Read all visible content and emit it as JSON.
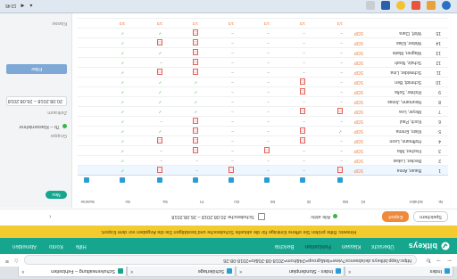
{
  "browser": {
    "tabs": [
      {
        "label": "Index",
        "active": false
      },
      {
        "label": "Index - Stundenplan",
        "active": false
      },
      {
        "label": "Schülertage",
        "active": false
      },
      {
        "label": "Schulverwaltung – Fehlzeiten",
        "active": true
      }
    ],
    "url": "https://app.bitkeys.de/absence?view=list&group=24&from=2018-08-20&to=2018-08-26",
    "clock_time": "12:45",
    "clock_date": "22.03.2018"
  },
  "app": {
    "brand": "bitkeys",
    "nav": [
      {
        "label": "Übersicht",
        "selected": false
      },
      {
        "label": "Klassen",
        "selected": false
      },
      {
        "label": "Fehlzeiten",
        "selected": true
      },
      {
        "label": "Berichte",
        "selected": false
      }
    ],
    "nav_right": [
      "Hilfe",
      "Konto",
      "Abmelden"
    ],
    "banner": "Hinweis: Bitte prüfen Sie offene Einträge für die aktuelle Schulwoche und bestätigen Sie die Angaben vor dem Export."
  },
  "toolbar": {
    "prev_label": "‹",
    "range_label": "Schulwoche 20.08.2018 – 26.08.2018",
    "status_label": "Alle aktiv",
    "export_label": "Export",
    "action_label": "Speichern"
  },
  "sidebar": {
    "class_label": "Klasse",
    "class_value": "7b – Klassenlehrer",
    "group_label": "Gruppe",
    "date_label": "Zeitraum",
    "date_value": "20.08.2018 – 26.08.2018",
    "apply_label": "Filter",
    "add_label": "Neu",
    "footer_label": "Mo 20.08"
  },
  "grid": {
    "headers": [
      "Nr.",
      "Schüler",
      "Kl.",
      "Mo",
      "Di",
      "Mi",
      "Do",
      "Fr",
      "Sa",
      "So",
      "Summe"
    ],
    "rows": [
      {
        "nr": "1",
        "name": "Bauer, Anna",
        "cls": "SOP",
        "m": [
          "box",
          "-",
          "-",
          "box",
          "-",
          "box",
          "ok"
        ]
      },
      {
        "nr": "2",
        "name": "Becker, Lukas",
        "cls": "SOP",
        "m": [
          "-",
          "-",
          "-",
          "-",
          "-",
          "-",
          "ok"
        ]
      },
      {
        "nr": "3",
        "name": "Fischer, Mia",
        "cls": "SOP",
        "m": [
          "-",
          "-",
          "box",
          "-",
          "box",
          "-",
          "ok"
        ]
      },
      {
        "nr": "4",
        "name": "Hoffmann, Leon",
        "cls": "SOP",
        "m": [
          "-",
          "box",
          "-",
          "-",
          "box",
          "box",
          "ok"
        ]
      },
      {
        "nr": "5",
        "name": "Klein, Emma",
        "cls": "SOP",
        "m": [
          "ok",
          "box",
          "-",
          "-",
          "box",
          "ok",
          "ok"
        ]
      },
      {
        "nr": "6",
        "name": "Koch, Paul",
        "cls": "SOP",
        "m": [
          "-",
          "-",
          "-",
          "-",
          "box",
          "-",
          "ok"
        ]
      },
      {
        "nr": "7",
        "name": "Meyer, Lea",
        "cls": "SOP",
        "m": [
          "box",
          "box",
          "-",
          "-",
          "ok",
          "ok",
          "ok"
        ]
      },
      {
        "nr": "8",
        "name": "Neumann, Jonas",
        "cls": "SOP",
        "m": [
          "-",
          "-",
          "-",
          "-",
          "ok",
          "ok",
          "ok"
        ]
      },
      {
        "nr": "9",
        "name": "Richter, Sofia",
        "cls": "SOP",
        "m": [
          "-",
          "box",
          "-",
          "-",
          "ok",
          "ok",
          "ok"
        ]
      },
      {
        "nr": "10",
        "name": "Schmidt, Ben",
        "cls": "SOP",
        "m": [
          "-",
          "box",
          "-",
          "-",
          "ok",
          "ok",
          "ok"
        ]
      },
      {
        "nr": "11",
        "name": "Schneider, Lina",
        "cls": "SOP",
        "m": [
          "-",
          "-",
          "-",
          "-",
          "box",
          "box",
          "ok"
        ]
      },
      {
        "nr": "12",
        "name": "Schulz, Noah",
        "cls": "SOP",
        "m": [
          "-",
          "-",
          "-",
          "-",
          "box",
          "-",
          "ok"
        ]
      },
      {
        "nr": "13",
        "name": "Wagner, Marie",
        "cls": "SOP",
        "m": [
          "-",
          "-",
          "-",
          "-",
          "box",
          "ok",
          "ok"
        ]
      },
      {
        "nr": "14",
        "name": "Weber, Elias",
        "cls": "SOP",
        "m": [
          "-",
          "-",
          "-",
          "-",
          "box",
          "box",
          "ok"
        ]
      },
      {
        "nr": "15",
        "name": "Wolf, Clara",
        "cls": "SOP",
        "m": [
          "-",
          "-",
          "-",
          "-",
          "box",
          "ok",
          "ok"
        ]
      }
    ],
    "totals": [
      "1/3",
      "1/3",
      "1/3",
      "1/3",
      "1/3",
      "2/3",
      "3/3"
    ]
  },
  "taskbar": {
    "clock": "12:45"
  }
}
